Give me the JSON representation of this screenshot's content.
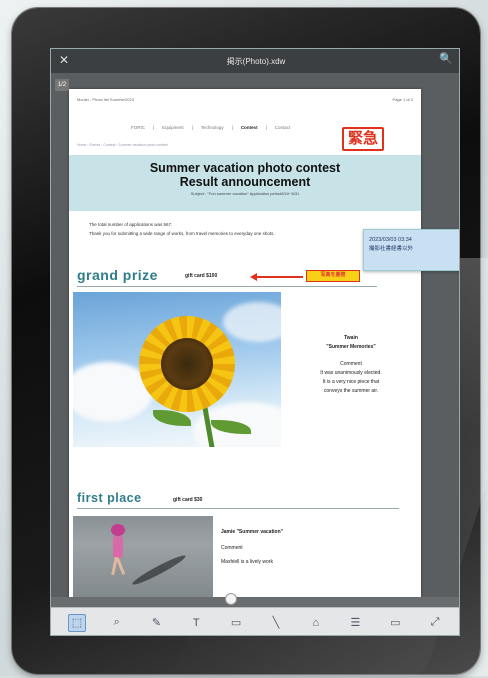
{
  "app": {
    "title": "掲示(Photo).xdw",
    "page_tag": "1/2",
    "close_glyph": "✕",
    "search_glyph": "🔍"
  },
  "document": {
    "header_left": "Moulin - Photo list Summer2023",
    "header_right": "Page 1 of 2",
    "nav": [
      "FORIC",
      "Equipment",
      "Technology",
      "Contest",
      "Contact"
    ],
    "crumbs": "Home › Events › Contest › Summer vacation photo contest",
    "stamp": "緊急",
    "title_line1": "Summer vacation photo contest",
    "title_line2": "Result announcement",
    "subject": "Subject : \"Fun summer vacation\" Application period8/10~8/31",
    "intro_line1": "The total number of applications was 567.",
    "intro_line2": "Thank you for submitting a wide range of works, from travel memories to everyday one shots.",
    "grand_prize": {
      "heading": "grand prize",
      "gift": "gift card $100",
      "highlight": "写真を差替",
      "winner": "Twain",
      "work": "\"Summer Memories\"",
      "comment_label": "Comment",
      "comment_line1": "It was unanimously elected.",
      "comment_line2": "It is a very nice piece that",
      "comment_line3": "conveys the summer air."
    },
    "first_place": {
      "heading": "first place",
      "gift": "gift card $30",
      "winner_line": "Jamie   \"Summer vacation\"",
      "comment_label": "Comment",
      "comment_text": "Maxhiell is a lively work"
    }
  },
  "annotation_note": {
    "timestamp": "2023/03/03  03:34",
    "text": "撮影社書経書以外"
  },
  "toolbar": {
    "tools": [
      "select-tool",
      "zoom-tool",
      "pen-tool",
      "text-tool",
      "rectangle-tool",
      "line-tool",
      "stamp-tool",
      "list-tool",
      "memo-tool",
      "expand-tool"
    ],
    "glyphs": [
      "⬚",
      "⌕",
      "✎",
      "T",
      "▭",
      "╲",
      "⌂",
      "☰",
      "▭",
      "⤢"
    ]
  }
}
